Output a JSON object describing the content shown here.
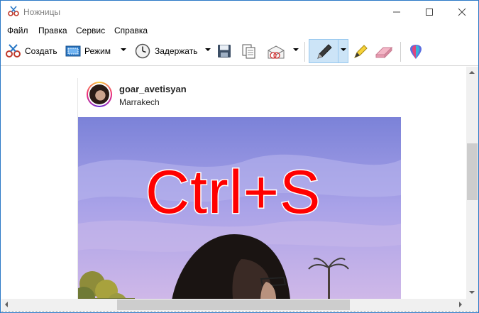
{
  "window": {
    "title": "Ножницы",
    "app_icon": "scissors-icon",
    "controls": [
      "minimize-icon",
      "maximize-icon",
      "close-icon"
    ]
  },
  "menu": {
    "items": [
      "Файл",
      "Правка",
      "Сервис",
      "Справка"
    ]
  },
  "toolbar": {
    "new_label": "Создать",
    "mode_label": "Режим",
    "delay_label": "Задержать",
    "icons": {
      "new": "scissors-icon",
      "mode": "rectangle-snip-icon",
      "delay": "clock-icon",
      "save": "save-icon",
      "copy": "copy-icon",
      "send": "send-email-icon",
      "pen": "pen-icon",
      "highlighter": "highlighter-icon",
      "eraser": "eraser-icon",
      "paint3d": "paint-3d-icon"
    },
    "active_tool": "pen"
  },
  "post": {
    "username": "goar_avetisyan",
    "location": "Marrakech"
  },
  "overlay": {
    "text": "Ctrl+S",
    "color": "#ff0000"
  },
  "colors": {
    "accent": "#2b79c6",
    "active_tool_bg": "#cce4f7"
  }
}
